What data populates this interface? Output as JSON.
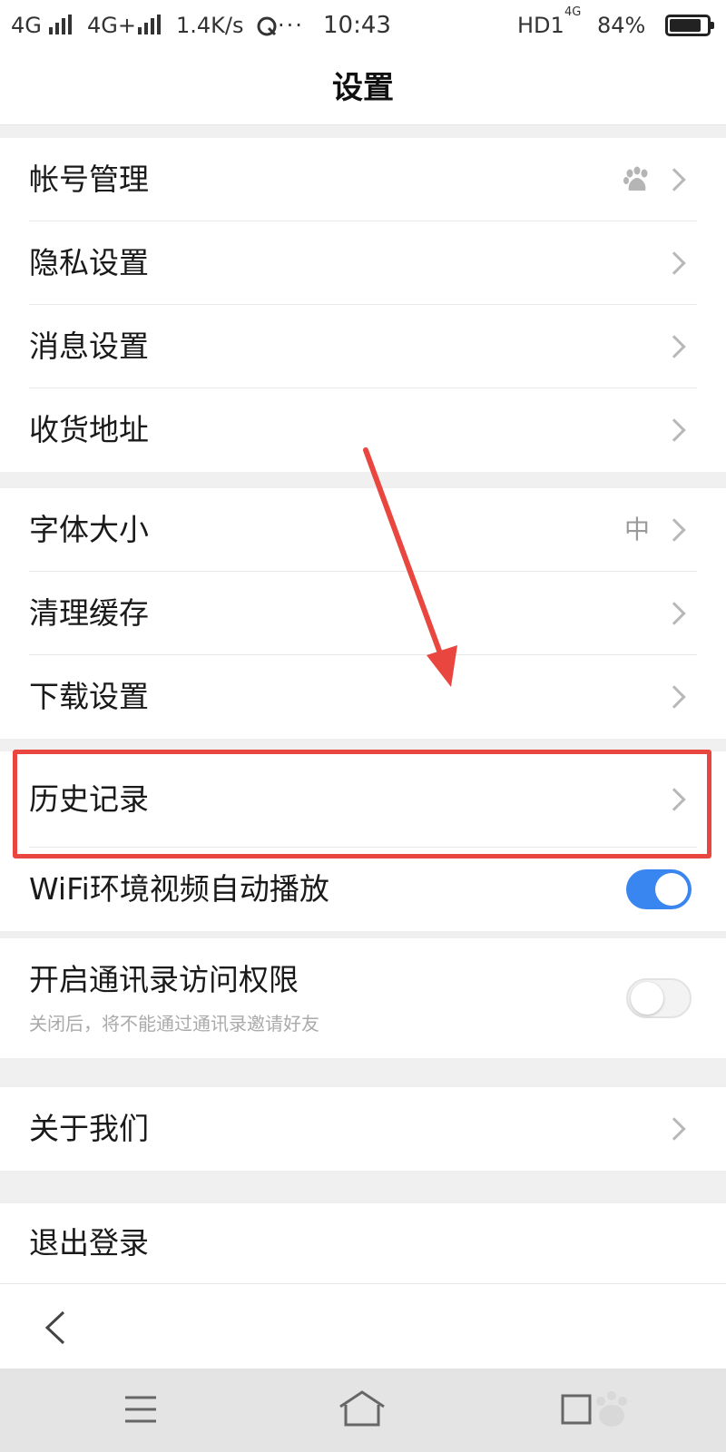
{
  "status_bar": {
    "network_1": "4G",
    "network_2": "4G+",
    "speed": "1.4K/s",
    "more": "···",
    "time": "10:43",
    "hd": "HD1",
    "net_small": "4G",
    "battery": "84%",
    "battery_level": 0.84
  },
  "page": {
    "title": "设置"
  },
  "groups": [
    {
      "items": [
        {
          "label": "帐号管理",
          "right_icon": "baidu-paw-icon"
        },
        {
          "label": "隐私设置"
        },
        {
          "label": "消息设置"
        },
        {
          "label": "收货地址"
        }
      ]
    },
    {
      "items": [
        {
          "label": "字体大小",
          "value": "中"
        },
        {
          "label": "清理缓存"
        },
        {
          "label": "下载设置"
        },
        {
          "label": "历史记录",
          "highlighted": true
        },
        {
          "label": "WiFi环境视频自动播放",
          "toggle": "on"
        }
      ]
    },
    {
      "items": [
        {
          "label": "开启通讯录访问权限",
          "subtitle": "关闭后，将不能通过通讯录邀请好友",
          "toggle": "off"
        }
      ]
    },
    {
      "items": [
        {
          "label": "关于我们"
        }
      ]
    },
    {
      "items": [
        {
          "label": "退出登录"
        }
      ]
    }
  ],
  "colors": {
    "toggle_on": "#3a86f0",
    "annotation_red": "#e9463f",
    "page_background": "#f0f0f0"
  },
  "icons": {
    "chevron": "chevron-right-icon",
    "back": "back-arrow-icon",
    "menu": "menu-icon",
    "home": "home-icon",
    "recent": "recent-apps-icon"
  }
}
